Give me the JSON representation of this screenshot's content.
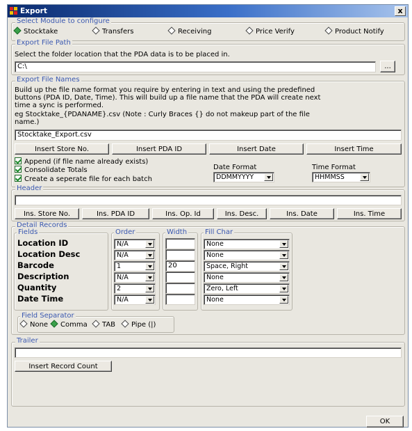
{
  "window": {
    "title": "Export",
    "close_glyph": "x"
  },
  "modules": {
    "legend": "Select Module to configure",
    "options": [
      {
        "label": "Stocktake",
        "selected": true
      },
      {
        "label": "Transfers",
        "selected": false
      },
      {
        "label": "Receiving",
        "selected": false
      },
      {
        "label": "Price Verify",
        "selected": false
      },
      {
        "label": "Product Notify",
        "selected": false
      }
    ]
  },
  "file_path": {
    "legend": "Export File Path",
    "instruction": "Select the folder location that the PDA data is to be placed in.",
    "value": "C:\\",
    "browse_label": "..."
  },
  "file_names": {
    "legend": "Export File Names",
    "description_lines": [
      "Build up the file name format you require by entering in text and using the predefined",
      "buttons (PDA ID, Date, Time).  This will build up a file name that the PDA will create next",
      "time a sync is performed.",
      "eg Stocktake_{PDANAME}.csv  (Note : Curly Braces {} do not makeup part of the file",
      "name.)"
    ],
    "value": "Stocktake_Export.csv",
    "buttons": [
      "Insert Store No.",
      "Insert PDA ID",
      "Insert Date",
      "Insert Time"
    ],
    "checkboxes": [
      {
        "label": "Append (if file name already exists)",
        "checked": true
      },
      {
        "label": "Consolidate Totals",
        "checked": true
      },
      {
        "label": "Create a seperate file for each batch",
        "checked": true
      }
    ],
    "date_format_label": "Date Format",
    "date_format_value": "DDMMYYYY",
    "time_format_label": "Time Format",
    "time_format_value": "HHMMSS"
  },
  "header": {
    "legend": "Header",
    "value": "",
    "buttons": [
      "Ins. Store No.",
      "Ins. PDA ID",
      "Ins. Op. Id",
      "Ins. Desc.",
      "Ins. Date",
      "Ins. Time"
    ]
  },
  "detail": {
    "legend": "Detail Records",
    "fields_legend": "Fields",
    "order_legend": "Order",
    "width_legend": "Width",
    "fill_legend": "Fill Char",
    "rows": [
      {
        "field": "Location ID",
        "order": "N/A",
        "width": "",
        "fill": "None"
      },
      {
        "field": "Location Desc",
        "order": "N/A",
        "width": "",
        "fill": "None"
      },
      {
        "field": "Barcode",
        "order": "1",
        "width": "20",
        "fill": "Space, Right"
      },
      {
        "field": "Description",
        "order": "N/A",
        "width": "",
        "fill": "None"
      },
      {
        "field": "Quantity",
        "order": "2",
        "width": "",
        "fill": "Zero, Left"
      },
      {
        "field": "Date Time",
        "order": "N/A",
        "width": "",
        "fill": "None"
      }
    ],
    "separator": {
      "legend": "Field Separator",
      "options": [
        {
          "label": "None",
          "selected": false
        },
        {
          "label": "Comma",
          "selected": true
        },
        {
          "label": "TAB",
          "selected": false
        },
        {
          "label": "Pipe (|)",
          "selected": false
        }
      ]
    }
  },
  "trailer": {
    "legend": "Trailer",
    "value": "",
    "button": "Insert Record Count"
  },
  "footer": {
    "ok_label": "OK"
  },
  "colors": {
    "title_start": "#0a2a6e",
    "title_end": "#a8c4ec",
    "legend": "#3a58b0",
    "radio_on": "#3aa04a",
    "face": "#e9e7e0"
  }
}
